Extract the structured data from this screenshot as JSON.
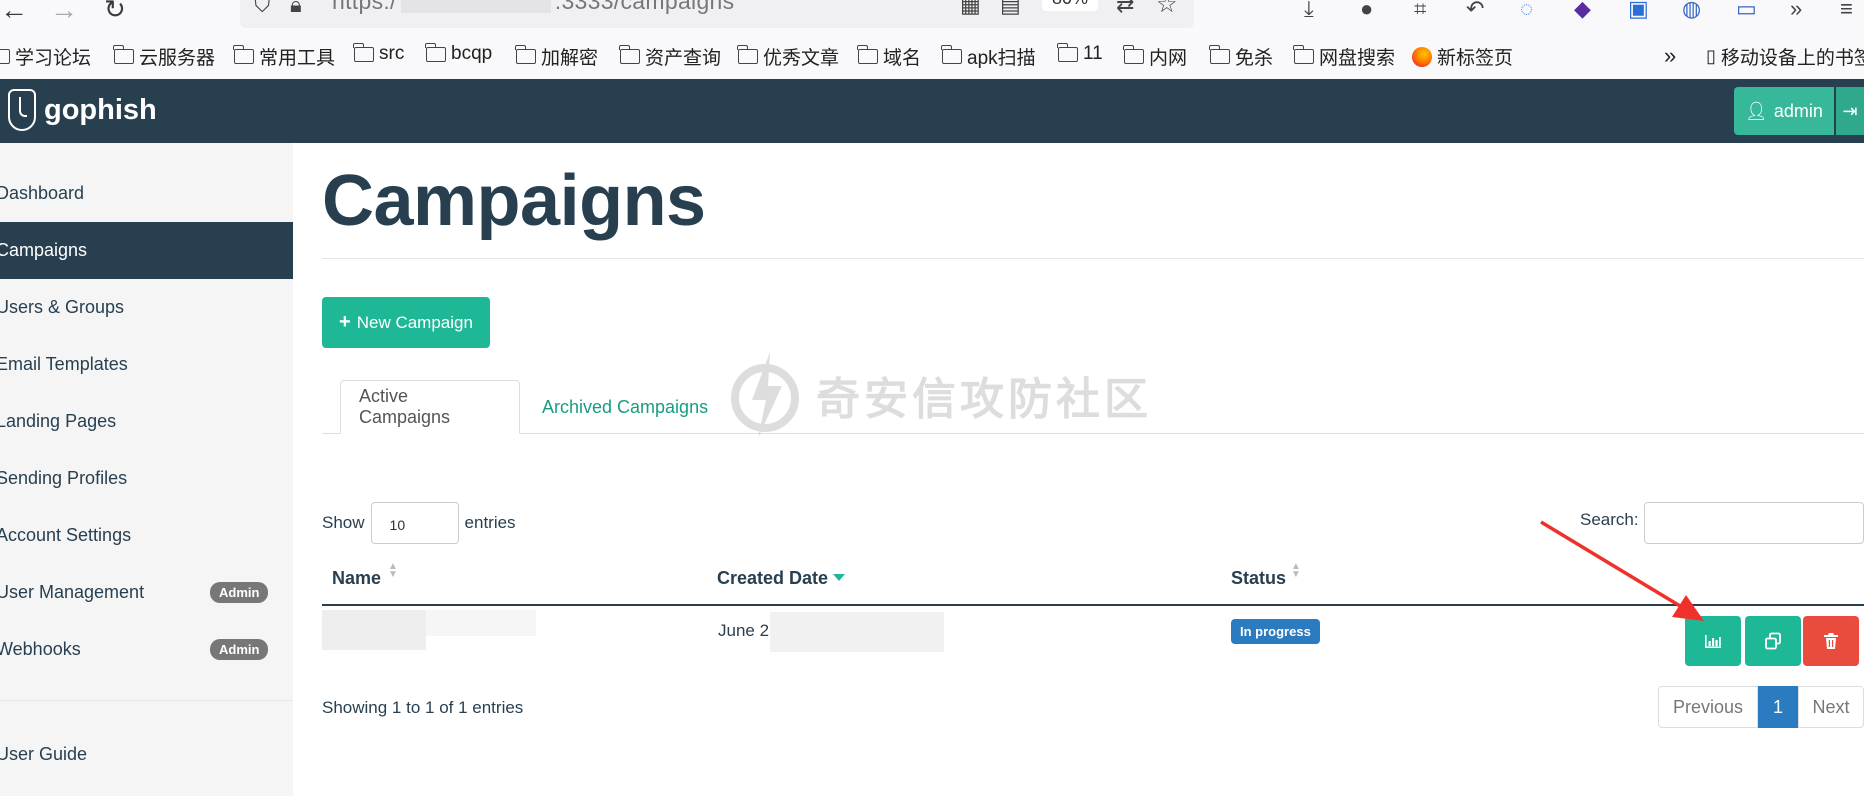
{
  "browser": {
    "url_prefix": "https:/",
    "url_suffix": ":3333/campaigns",
    "zoom": "80%",
    "bookmarks": [
      "学习论坛",
      "云服务器",
      "常用工具",
      "src",
      "bcqp",
      "加解密",
      "资产查询",
      "优秀文章",
      "域名",
      "apk扫描",
      "11",
      "内网",
      "免杀",
      "网盘搜索",
      "新标签页",
      "移动设备上的书签"
    ]
  },
  "navbar": {
    "brand": "gophish",
    "user_button": "admin"
  },
  "sidebar": {
    "items": [
      {
        "label": "Dashboard",
        "active": false
      },
      {
        "label": "Campaigns",
        "active": true
      },
      {
        "label": "Users & Groups",
        "active": false
      },
      {
        "label": "Email Templates",
        "active": false
      },
      {
        "label": "Landing Pages",
        "active": false
      },
      {
        "label": "Sending Profiles",
        "active": false
      },
      {
        "label": "Account Settings",
        "active": false
      },
      {
        "label": "User Management",
        "active": false,
        "badge": "Admin"
      },
      {
        "label": "Webhooks",
        "active": false,
        "badge": "Admin"
      }
    ],
    "footer_item": "User Guide"
  },
  "main": {
    "title": "Campaigns",
    "new_button": "New Campaign",
    "tabs": [
      "Active Campaigns",
      "Archived Campaigns"
    ],
    "watermark": "奇安信攻防社区",
    "show_label": "Show",
    "show_value": "10",
    "entries_label": "entries",
    "search_label": "Search:",
    "search_value": "",
    "columns": [
      "Name",
      "Created Date",
      "Status"
    ],
    "rows": [
      {
        "name": "",
        "created_date": "June 2",
        "status": "In progress"
      }
    ],
    "info": "Showing 1 to 1 of 1 entries",
    "pagination": {
      "previous": "Previous",
      "current": "1",
      "next": "Next"
    }
  },
  "colors": {
    "navbar": "#283f50",
    "accent": "#1fb897",
    "danger": "#e94c3d",
    "status_info": "#2a7bbf",
    "annotation_arrow": "#f0302a"
  }
}
